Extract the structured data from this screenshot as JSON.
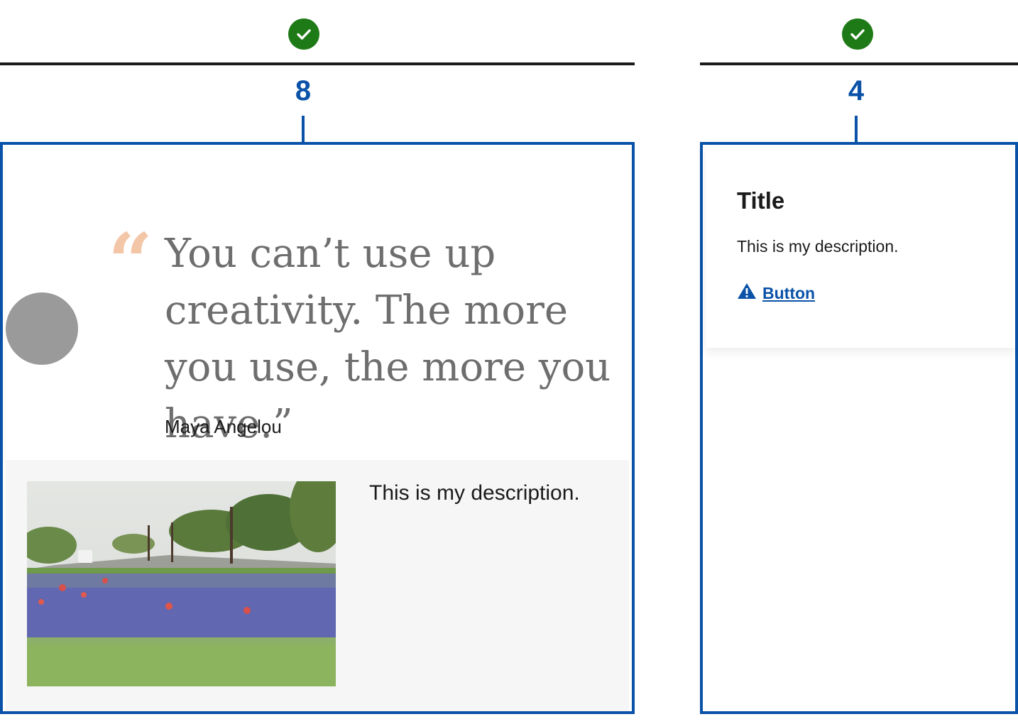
{
  "left_column": {
    "span_number": "8",
    "quote": {
      "text": "You can’t use up creativity. The more you use, the more you have.”",
      "author": "Maya Angelou",
      "quote_mark": "“"
    },
    "media": {
      "description": "This is my description.",
      "image_label": "Field of bluebonnet wildflowers along a road"
    }
  },
  "right_column": {
    "span_number": "4",
    "card": {
      "title": "Title",
      "description": "This is my description.",
      "button_label": "Button",
      "button_icon": "warning-icon"
    }
  },
  "colors": {
    "check_green": "#1e7a16",
    "accent_blue": "#0a52a8",
    "quote_mark": "#f4c6a8"
  }
}
